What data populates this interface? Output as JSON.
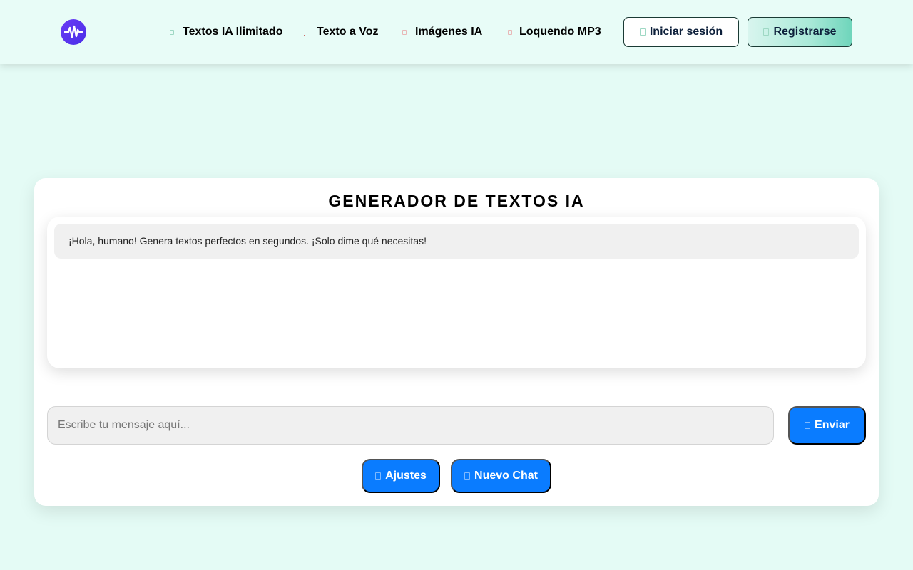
{
  "header": {
    "logo_icon": "sound-wave-icon",
    "nav": [
      {
        "label": "Textos IA Ilimitado",
        "icon": "text-icon"
      },
      {
        "label": "Texto a Voz",
        "icon": "voice-icon"
      },
      {
        "label": "Imágenes IA",
        "icon": "image-icon"
      },
      {
        "label": "Loquendo MP3",
        "icon": "music-icon"
      }
    ],
    "login_label": "Iniciar sesión",
    "register_label": "Registrarse"
  },
  "card": {
    "title": "GENERADOR DE TEXTOS IA",
    "messages": [
      {
        "role": "bot",
        "text": "¡Hola, humano! Genera textos perfectos en segundos. ¡Solo dime qué necesitas!"
      }
    ],
    "input": {
      "placeholder": "Escribe tu mensaje aquí...",
      "value": ""
    },
    "send_label": "Enviar",
    "settings_label": "Ajustes",
    "new_chat_label": "Nuevo Chat"
  },
  "colors": {
    "page_bg": "#e4fbf5",
    "accent_blue": "#0a7cff",
    "logo_purple": "#5b35f0"
  }
}
